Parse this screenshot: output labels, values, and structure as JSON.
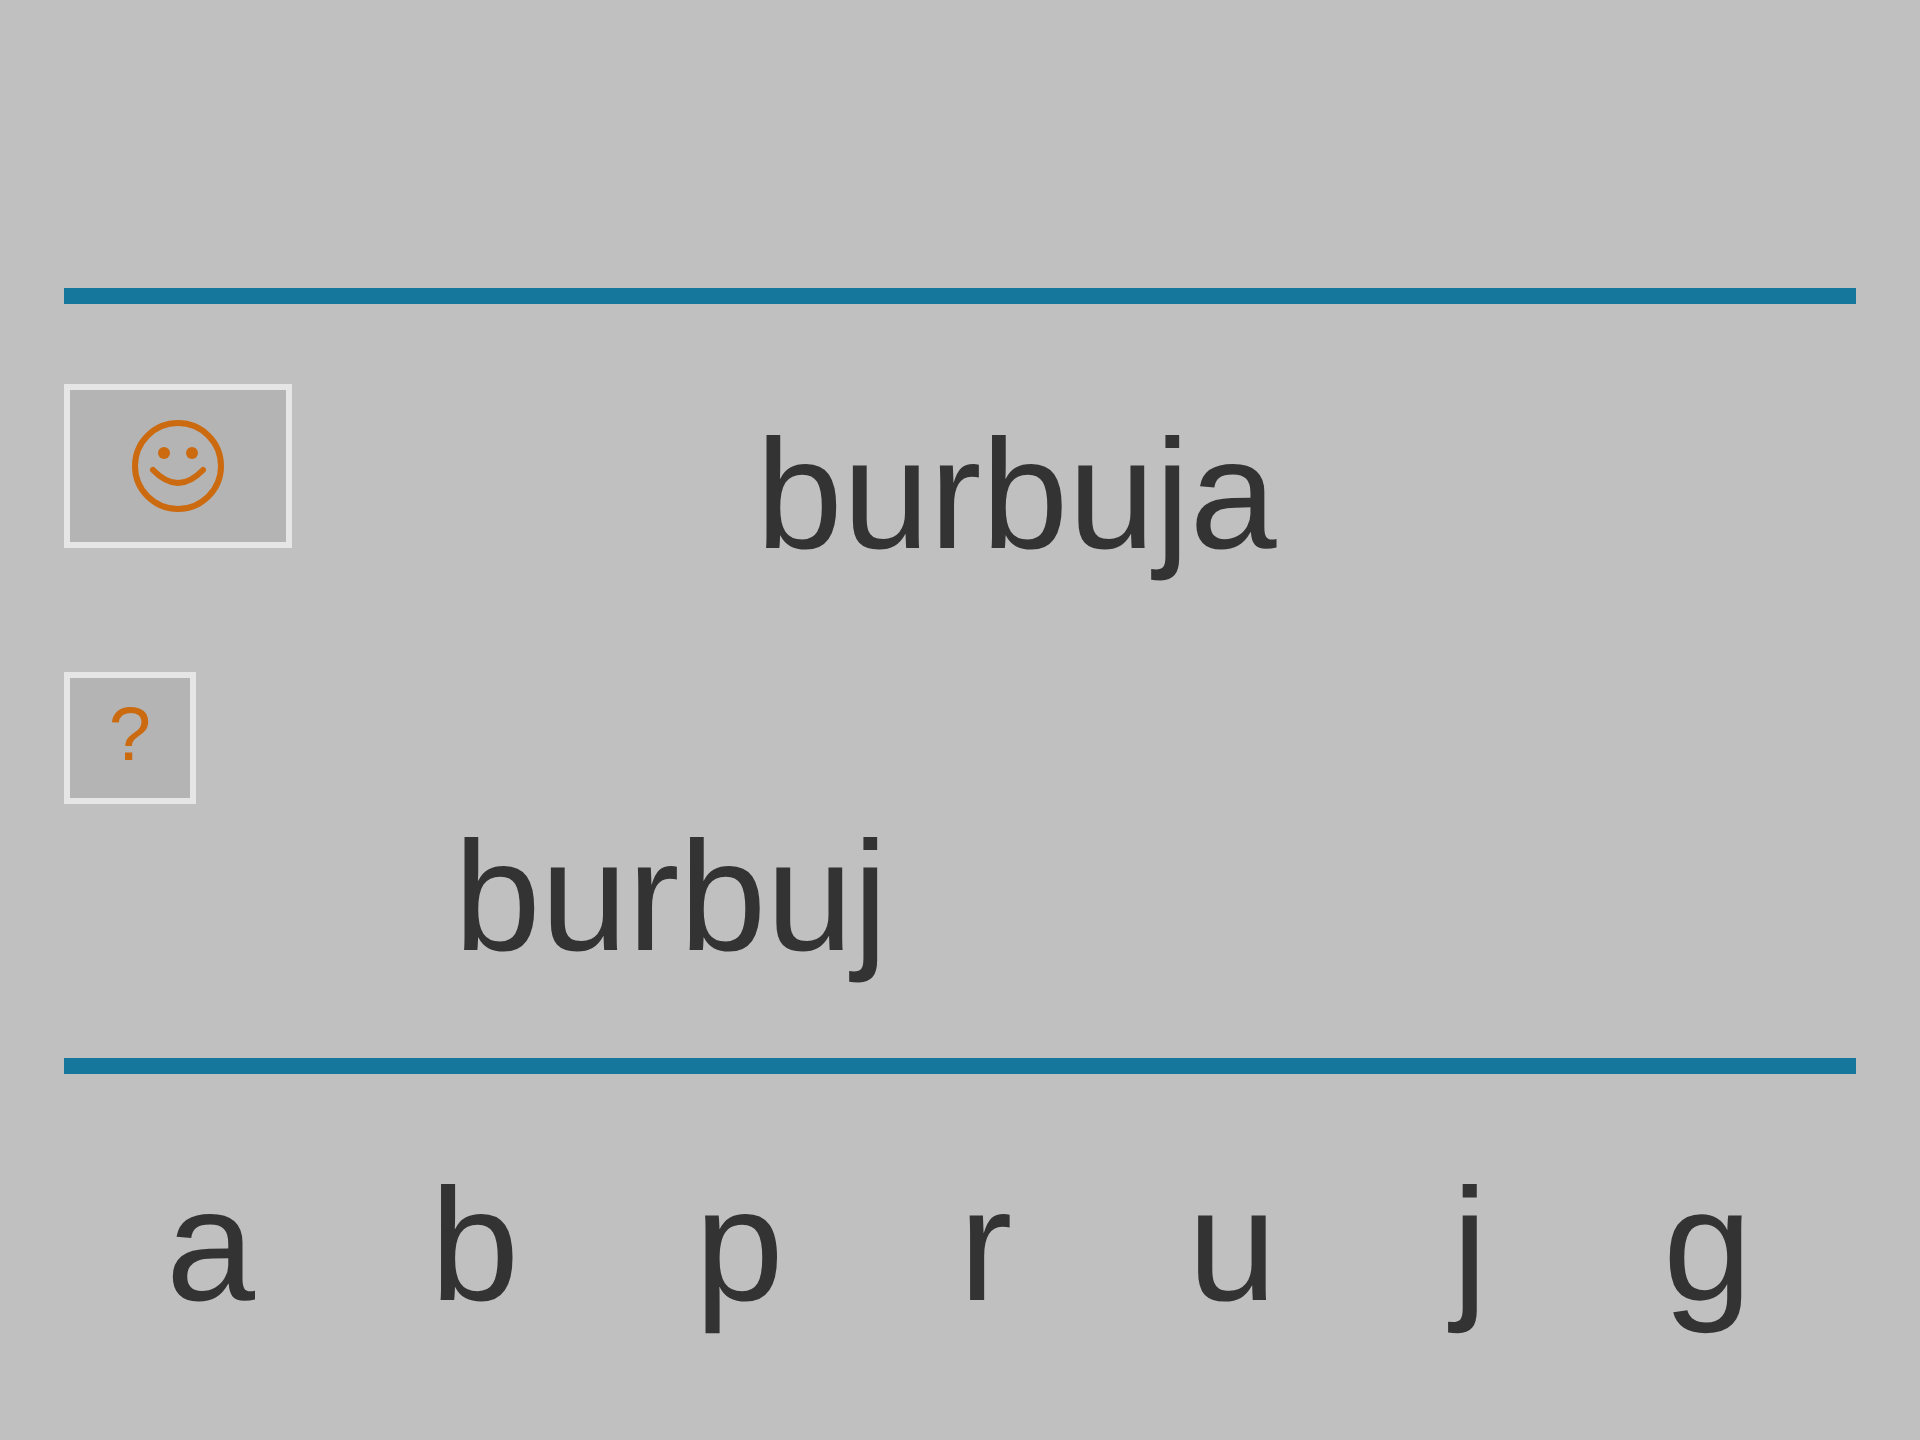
{
  "exercise": {
    "target_word": "burbuja",
    "hint_button": {
      "label": "?"
    },
    "answer": {
      "value": "burbuj"
    },
    "letter_choices": [
      "a",
      "b",
      "p",
      "r",
      "u",
      "j",
      "g"
    ]
  }
}
